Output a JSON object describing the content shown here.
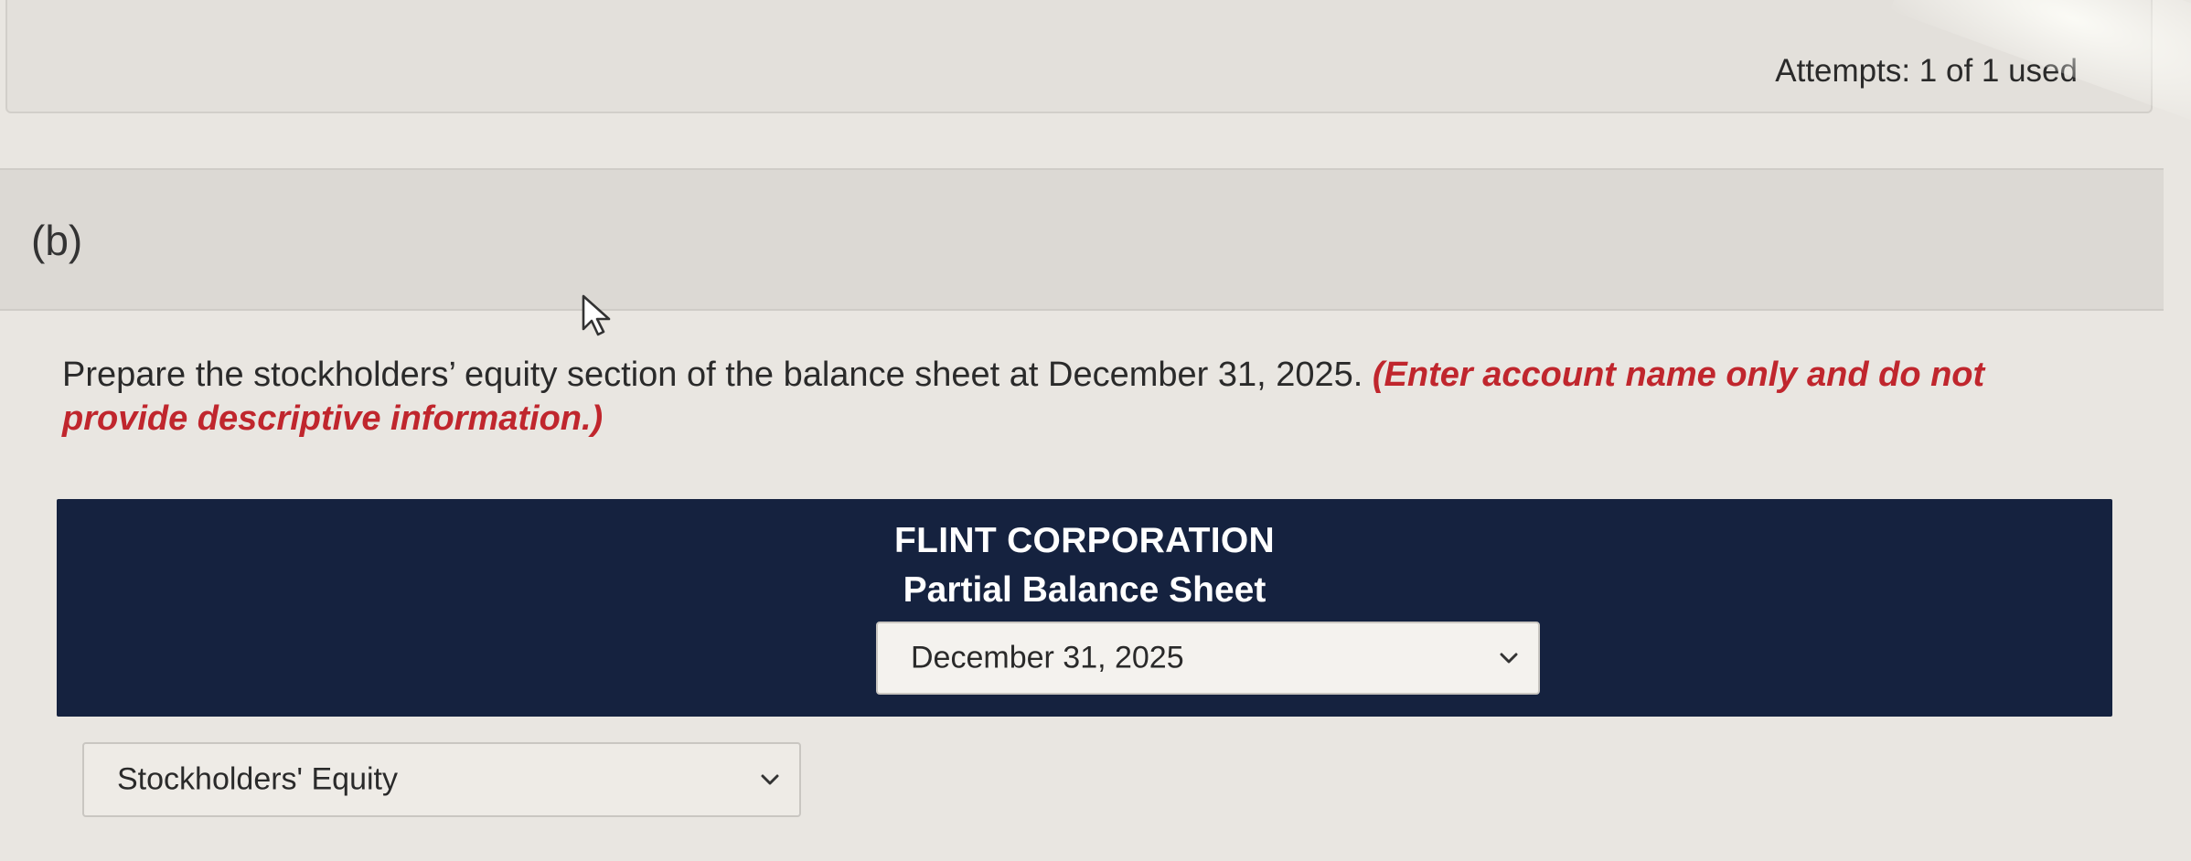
{
  "attempts": {
    "text": "Attempts: 1 of 1 used"
  },
  "part": {
    "label": "(b)"
  },
  "instructions": {
    "main": "Prepare the stockholders’ equity section of the balance sheet at December 31, 2025. ",
    "note": "(Enter account name only and do not provide descriptive information.)"
  },
  "statement": {
    "company": "FLINT CORPORATION",
    "title": "Partial Balance Sheet",
    "date_select": {
      "value": "December 31, 2025"
    }
  },
  "section_select": {
    "value": "Stockholders' Equity"
  },
  "icons": {
    "dropdown": "chevron-down-icon",
    "cursor": "cursor-arrow-icon"
  },
  "colors": {
    "header_bg": "#15223f",
    "note_red": "#c0262d"
  }
}
